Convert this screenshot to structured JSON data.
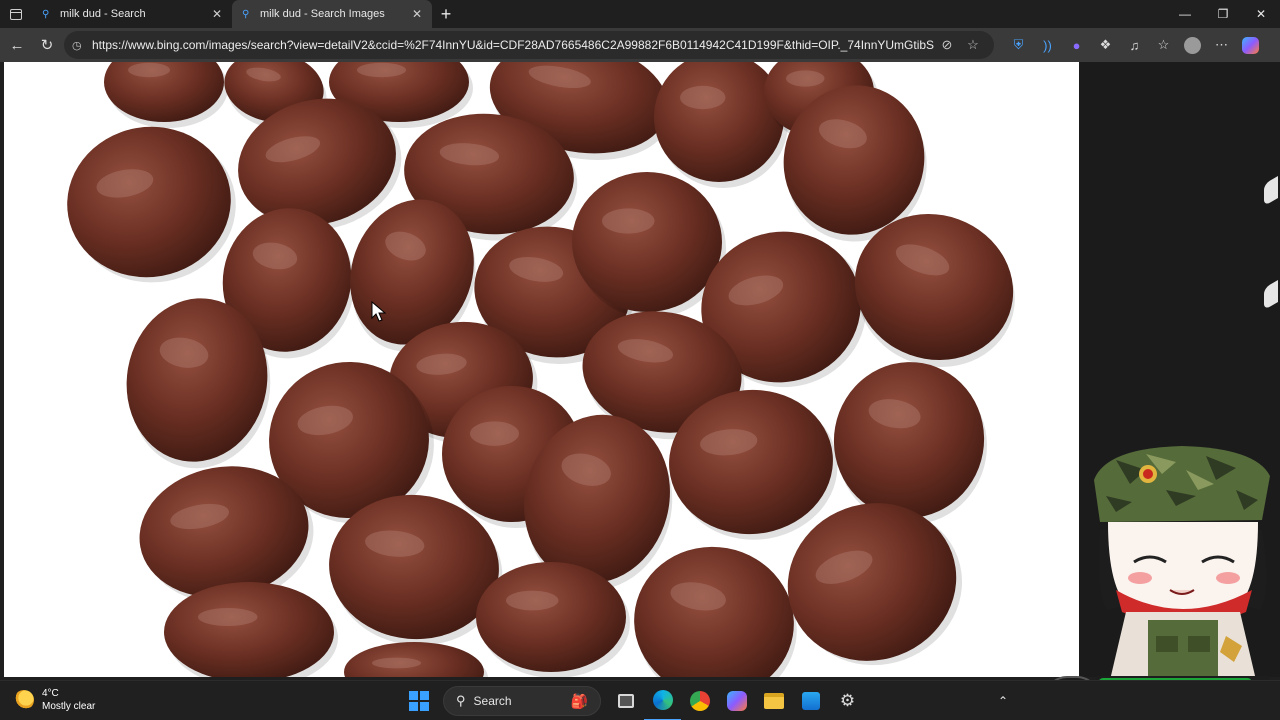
{
  "tabs": [
    {
      "title": "milk dud - Search",
      "active": false
    },
    {
      "title": "milk dud - Search Images",
      "active": true
    }
  ],
  "address": {
    "url": "https://www.bing.com/images/search?view=detailV2&ccid=%2F74InnYU&id=CDF28AD7665486C2A99882F6B0114942C41D199F&thid=OIP._74InnYUmGtibSQFG..."
  },
  "taskbar": {
    "weather_temp": "4°C",
    "weather_desc": "Mostly clear",
    "search_label": "Search"
  },
  "colors": {
    "accent": "#4aa3ff",
    "candy": "#6b2f23",
    "candy_highlight": "#b98a7e"
  },
  "icons": {
    "tab_actions": "tab-actions-icon",
    "back": "back-arrow-icon",
    "refresh": "refresh-icon",
    "favorites": "star-icon",
    "profile": "profile-icon",
    "more": "more-dots-icon",
    "copilot": "copilot-icon"
  }
}
